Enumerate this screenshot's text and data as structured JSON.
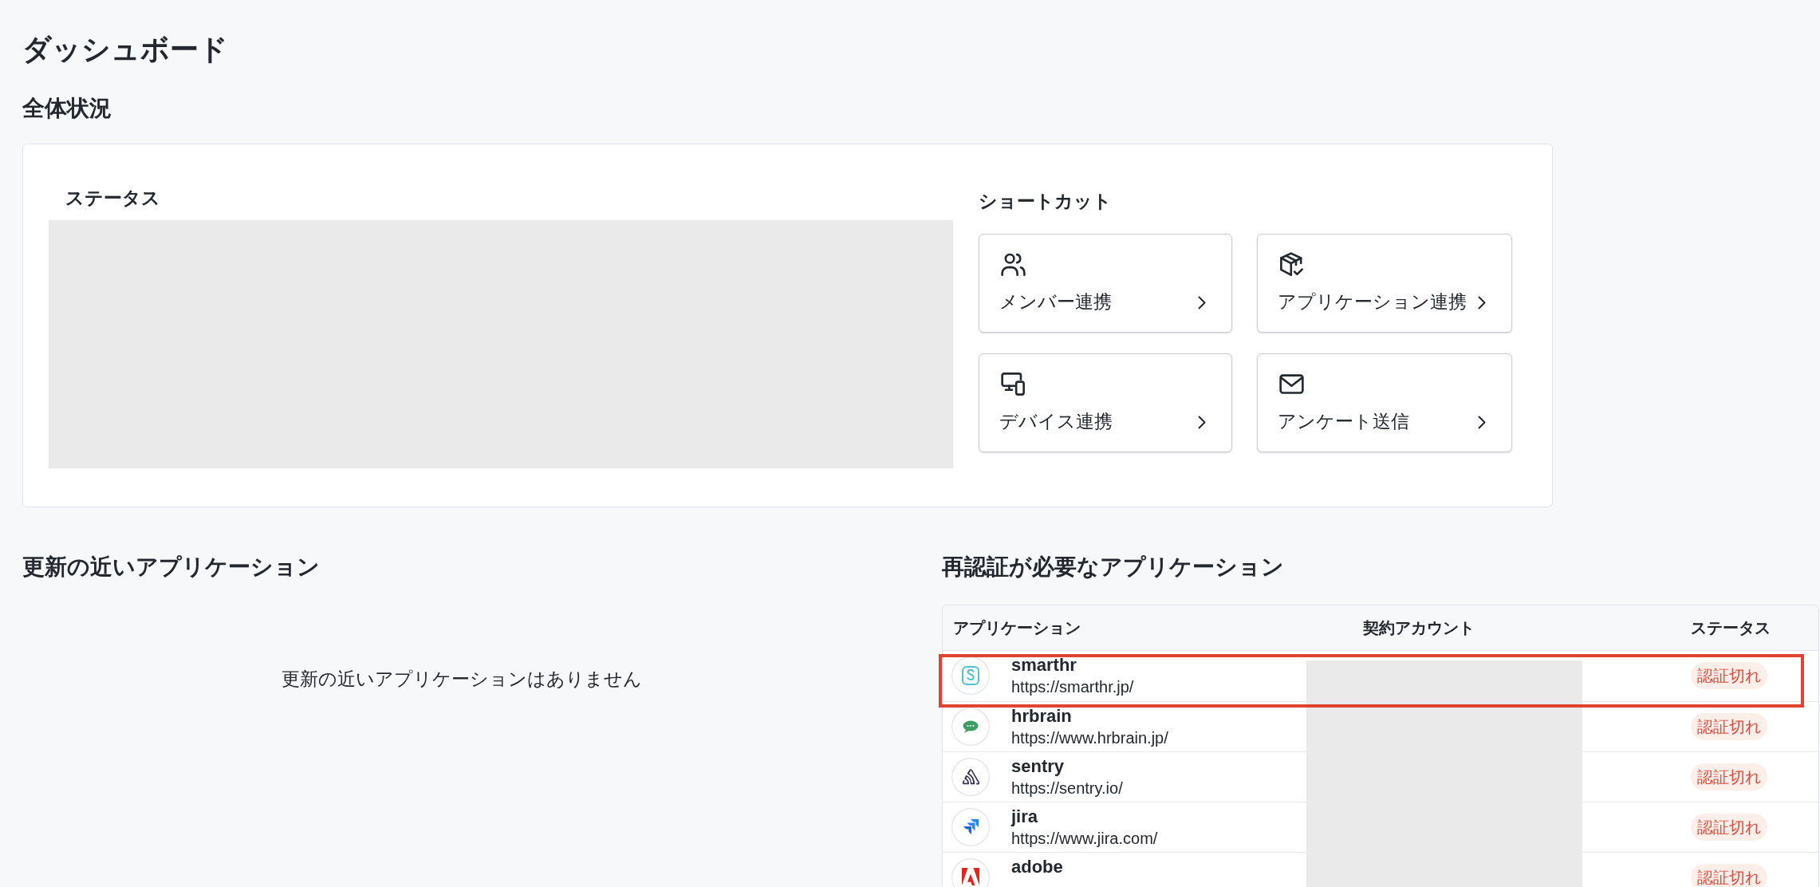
{
  "page": {
    "title": "ダッシュボード"
  },
  "overview": {
    "heading": "全体状況",
    "status": {
      "title": "ステータス",
      "redacted": true
    },
    "shortcuts": {
      "title": "ショートカット",
      "items": [
        {
          "label": "メンバー連携"
        },
        {
          "label": "アプリケーション連携"
        },
        {
          "label": "デバイス連携"
        },
        {
          "label": "アンケート送信"
        }
      ]
    }
  },
  "renewals": {
    "heading": "更新の近いアプリケーション",
    "empty_message": "更新の近いアプリケーションはありません"
  },
  "reauth": {
    "heading": "再認証が必要なアプリケーション",
    "table": {
      "columns": [
        "アプリケーション",
        "契約アカウント",
        "ステータス"
      ],
      "account_redacted": true,
      "rows": [
        {
          "name": "smarthr",
          "url": "https://smarthr.jp/",
          "status": "認証切れ",
          "highlighted": true
        },
        {
          "name": "hrbrain",
          "url": "https://www.hrbrain.jp/",
          "status": "認証切れ",
          "highlighted": false
        },
        {
          "name": "sentry",
          "url": "https://sentry.io/",
          "status": "認証切れ",
          "highlighted": false
        },
        {
          "name": "jira",
          "url": "https://www.jira.com/",
          "status": "認証切れ",
          "highlighted": false
        },
        {
          "name": "adobe",
          "status": "認証切れ",
          "highlighted": false
        }
      ]
    }
  }
}
